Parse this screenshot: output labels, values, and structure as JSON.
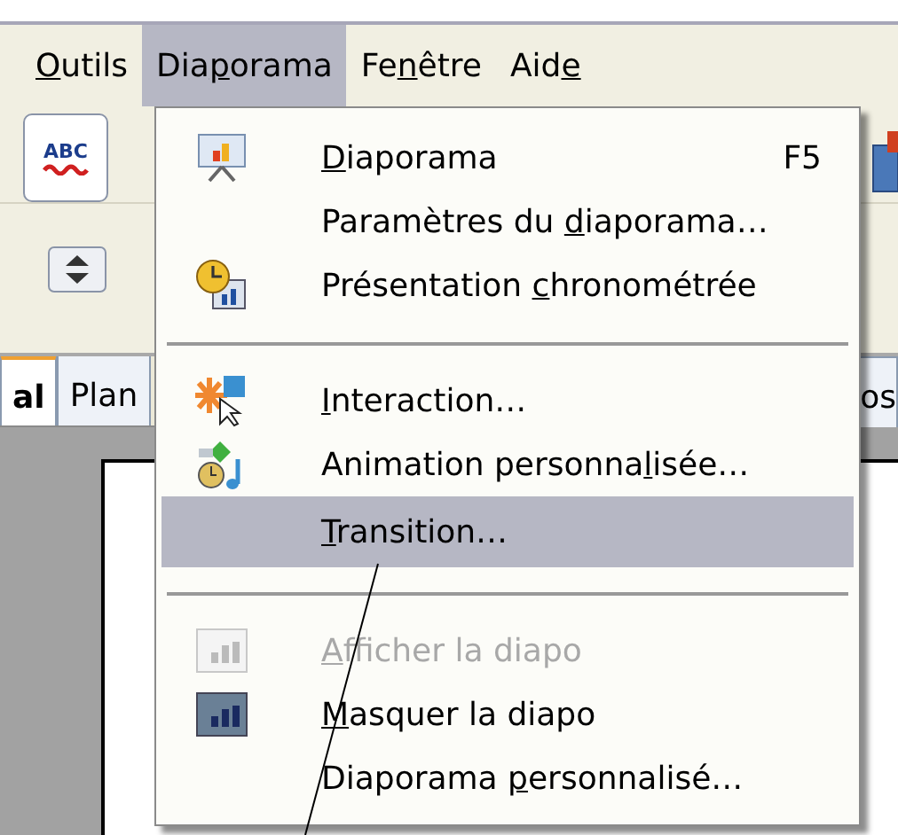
{
  "menubar": [
    {
      "label": [
        {
          "text": "O",
          "underlined": true
        },
        {
          "text": "utils",
          "underlined": false
        }
      ],
      "selected": false
    },
    {
      "label": [
        {
          "text": "Dia",
          "underlined": false
        },
        {
          "text": "p",
          "underlined": true
        },
        {
          "text": "orama",
          "underlined": false
        }
      ],
      "selected": true
    },
    {
      "label": [
        {
          "text": "Fe",
          "underlined": false
        },
        {
          "text": "n",
          "underlined": true
        },
        {
          "text": "être",
          "underlined": false
        }
      ],
      "selected": false
    },
    {
      "label": [
        {
          "text": "Aid",
          "underlined": false
        },
        {
          "text": "e",
          "underlined": true
        }
      ],
      "selected": false
    }
  ],
  "toolbar": {
    "spellcheck_label": "ABC"
  },
  "tabs": [
    {
      "label": "al",
      "selected": true
    },
    {
      "label": "Plan",
      "selected": false
    }
  ],
  "right_tab": {
    "label": "os"
  },
  "menu": [
    {
      "kind": "item",
      "label": [
        {
          "text": "D",
          "underlined": true
        },
        {
          "text": "iaporama",
          "underlined": false
        }
      ],
      "shortcut": "F5",
      "disabled": false,
      "selected": false
    },
    {
      "kind": "item",
      "label": [
        {
          "text": "Paramètres du ",
          "underlined": false
        },
        {
          "text": "d",
          "underlined": true
        },
        {
          "text": "iaporama…",
          "underlined": false
        }
      ],
      "disabled": false,
      "selected": false
    },
    {
      "kind": "item",
      "label": [
        {
          "text": "Présentation ",
          "underlined": false
        },
        {
          "text": "c",
          "underlined": true
        },
        {
          "text": "hronométrée",
          "underlined": false
        }
      ],
      "disabled": false,
      "selected": false
    },
    {
      "kind": "separator"
    },
    {
      "kind": "item",
      "label": [
        {
          "text": "I",
          "underlined": true
        },
        {
          "text": "nteraction…",
          "underlined": false
        }
      ],
      "disabled": false,
      "selected": false
    },
    {
      "kind": "item",
      "label": [
        {
          "text": "Animation personna",
          "underlined": false
        },
        {
          "text": "l",
          "underlined": true
        },
        {
          "text": "isée…",
          "underlined": false
        }
      ],
      "disabled": false,
      "selected": false
    },
    {
      "kind": "item",
      "label": [
        {
          "text": "T",
          "underlined": true
        },
        {
          "text": "ransition…",
          "underlined": false
        }
      ],
      "disabled": false,
      "selected": true
    },
    {
      "kind": "separator"
    },
    {
      "kind": "item",
      "label": [
        {
          "text": "A",
          "underlined": true
        },
        {
          "text": "fficher la diapo",
          "underlined": false
        }
      ],
      "disabled": true,
      "selected": false
    },
    {
      "kind": "item",
      "label": [
        {
          "text": "M",
          "underlined": true
        },
        {
          "text": "asquer la diapo",
          "underlined": false
        }
      ],
      "disabled": false,
      "selected": false
    },
    {
      "kind": "item",
      "label": [
        {
          "text": "Diaporama ",
          "underlined": false
        },
        {
          "text": "p",
          "underlined": true
        },
        {
          "text": "ersonnalisé…",
          "underlined": false
        }
      ],
      "disabled": false,
      "selected": false
    }
  ]
}
